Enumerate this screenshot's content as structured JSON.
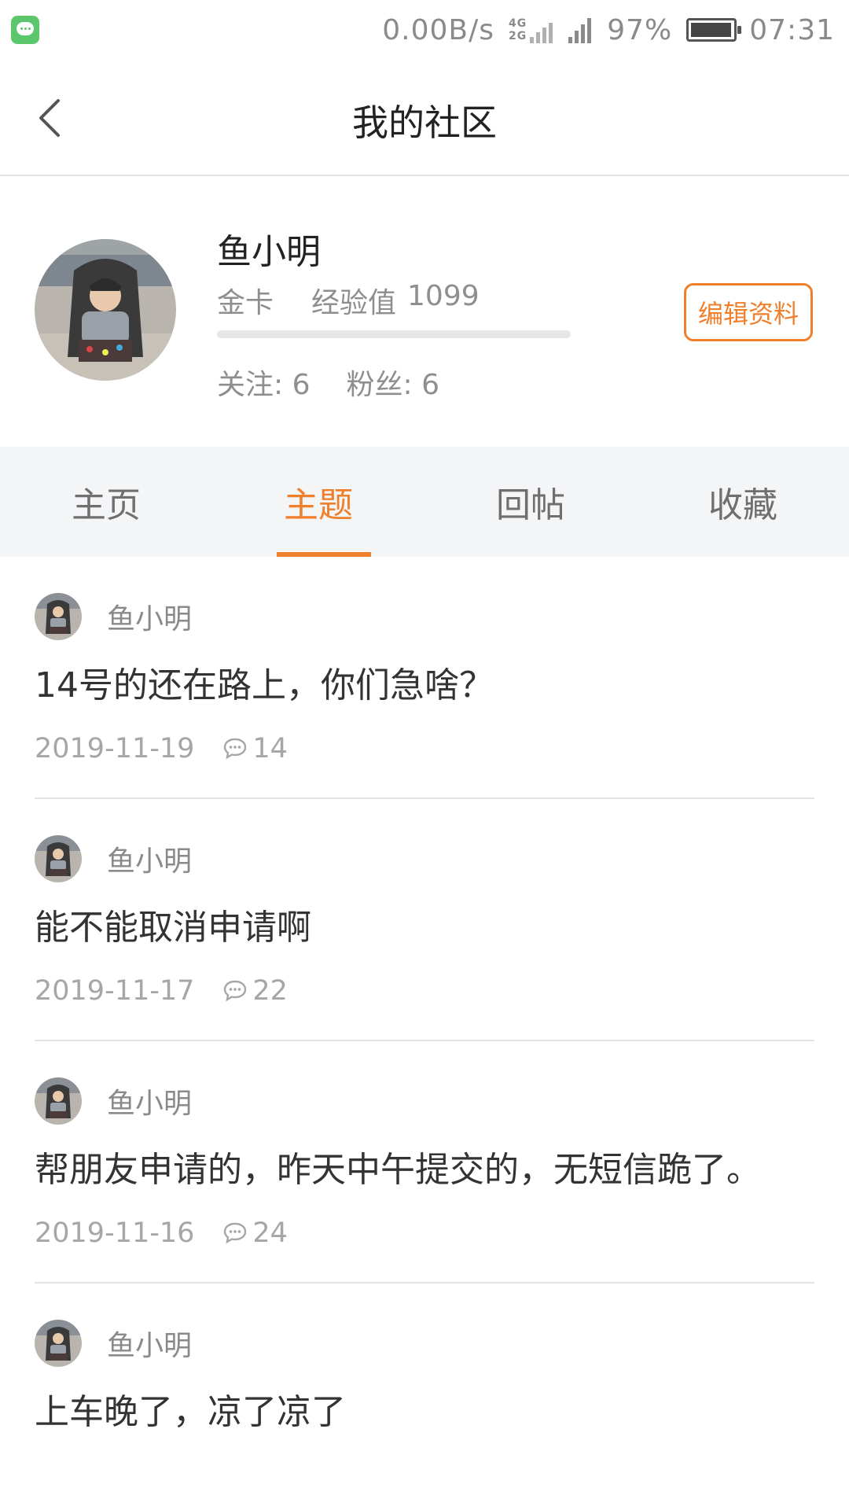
{
  "status_bar": {
    "net_speed": "0.00B/s",
    "net_type_top": "4G",
    "net_type_bottom": "2G",
    "signal_label": "G",
    "battery_percent": "97%",
    "battery_level": 0.97,
    "time": "07:31"
  },
  "header": {
    "title": "我的社区"
  },
  "profile": {
    "username": "鱼小明",
    "card_level": "金卡",
    "exp_label": "经验值",
    "exp_value": "1099",
    "exp_progress": 0.0,
    "follow_label": "关注",
    "follow_count": "6",
    "fans_label": "粉丝",
    "fans_count": "6",
    "colon": ":",
    "edit_label": "编辑资料"
  },
  "tabs": [
    {
      "label": "主页",
      "active": false
    },
    {
      "label": "主题",
      "active": true
    },
    {
      "label": "回帖",
      "active": false
    },
    {
      "label": "收藏",
      "active": false
    }
  ],
  "posts": [
    {
      "author": "鱼小明",
      "title": "14号的还在路上，你们急啥？",
      "date": "2019-11-19",
      "comments": "14"
    },
    {
      "author": "鱼小明",
      "title": "能不能取消申请啊",
      "date": "2019-11-17",
      "comments": "22"
    },
    {
      "author": "鱼小明",
      "title": "帮朋友申请的，昨天中午提交的，无短信跪了。",
      "date": "2019-11-16",
      "comments": "24"
    },
    {
      "author": "鱼小明",
      "title": "上车晚了，凉了凉了",
      "date": "",
      "comments": ""
    }
  ],
  "colors": {
    "accent": "#f07f2c",
    "tab_bg": "#f4f5f7",
    "divider": "#e3e3e3"
  }
}
